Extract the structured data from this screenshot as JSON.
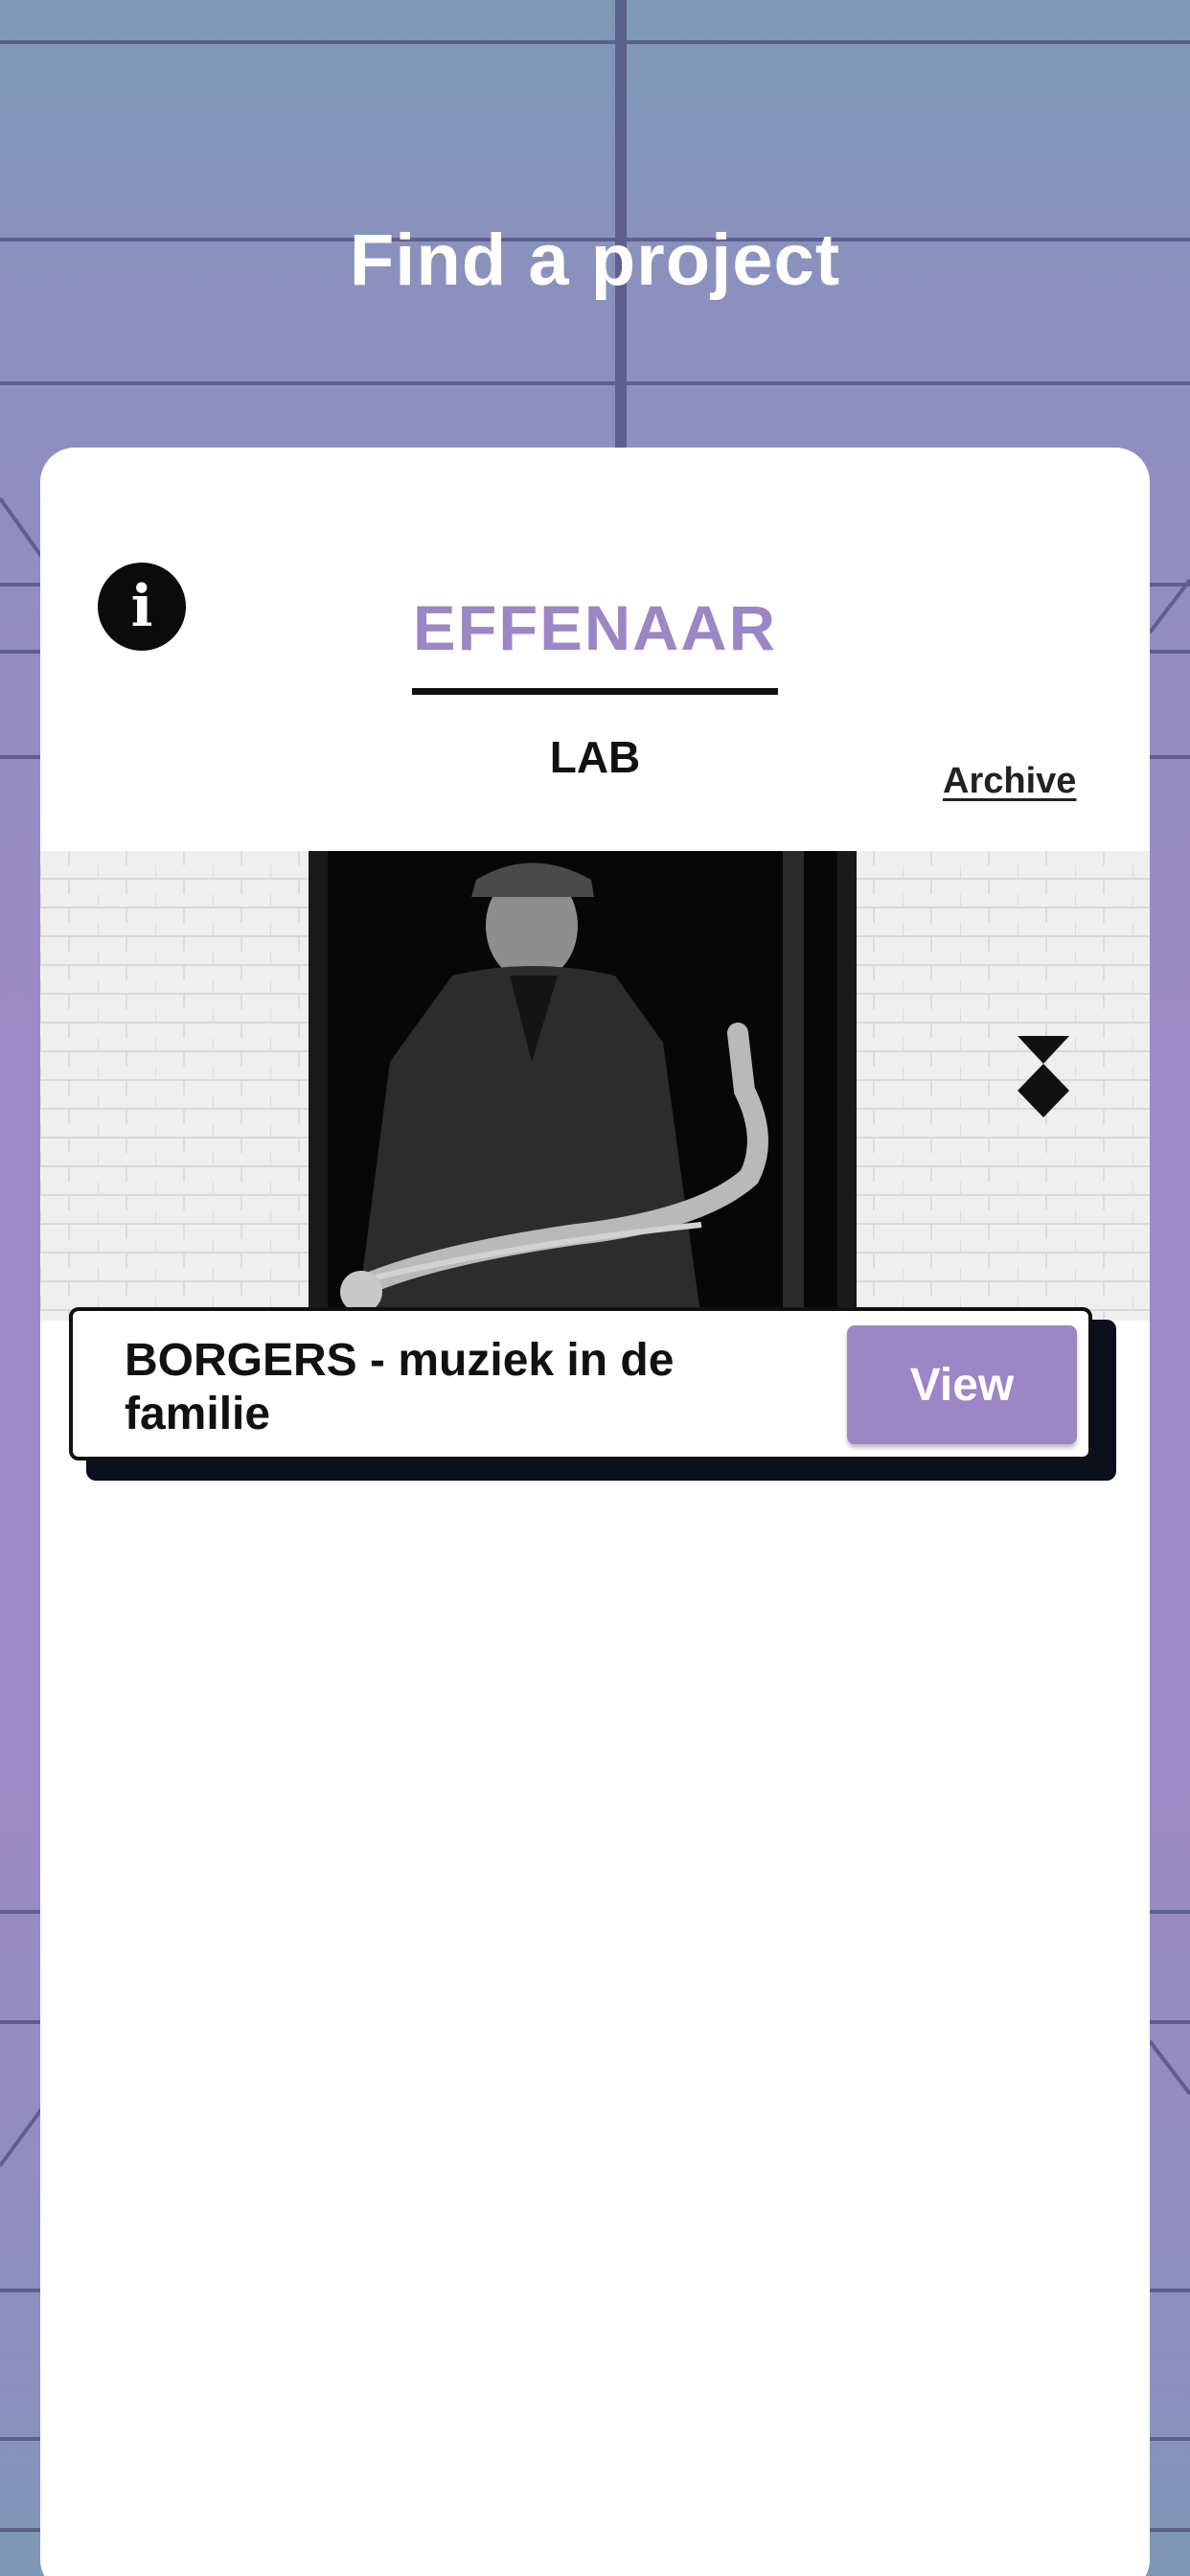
{
  "header": {
    "title": "Find a project"
  },
  "card": {
    "info_icon": "info-icon",
    "info_glyph": "i",
    "logo_text": "EFFENAAR",
    "tab_label": "LAB",
    "archive_label": "Archive"
  },
  "project": {
    "title": "BORGERS - muziek in de familie",
    "view_label": "View",
    "image_icon": "effenaar-diamond-mark-icon"
  },
  "colors": {
    "accent": "#9b86c6",
    "background_top": "#7e99b6",
    "background_mid": "#9a8ac5",
    "card": "#ffffff",
    "dark": "#111111"
  }
}
